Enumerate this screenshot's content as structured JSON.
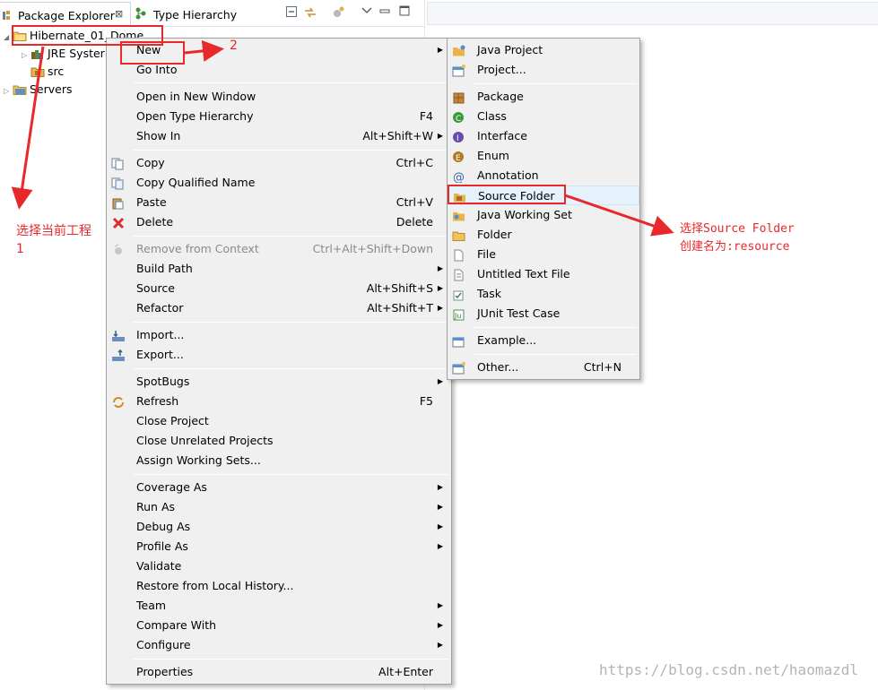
{
  "tabs": {
    "package_explorer": "Package Explorer",
    "close_glyph": "⊠",
    "type_hierarchy": "Type Hierarchy"
  },
  "tree": {
    "project": "Hibernate_01_Dome",
    "jre": "JRE Syster",
    "src": "src",
    "servers": "Servers"
  },
  "context_menu": {
    "new": "New",
    "go_into": "Go Into",
    "open_new_window": "Open in New Window",
    "open_type_hierarchy": "Open Type Hierarchy",
    "open_type_hierarchy_acc": "F4",
    "show_in": "Show In",
    "show_in_acc": "Alt+Shift+W",
    "copy": "Copy",
    "copy_acc": "Ctrl+C",
    "copy_qualified": "Copy Qualified Name",
    "paste": "Paste",
    "paste_acc": "Ctrl+V",
    "delete": "Delete",
    "delete_acc": "Delete",
    "remove_context": "Remove from Context",
    "remove_context_acc": "Ctrl+Alt+Shift+Down",
    "build_path": "Build Path",
    "source": "Source",
    "source_acc": "Alt+Shift+S",
    "refactor": "Refactor",
    "refactor_acc": "Alt+Shift+T",
    "import": "Import...",
    "export": "Export...",
    "spotbugs": "SpotBugs",
    "refresh": "Refresh",
    "refresh_acc": "F5",
    "close_project": "Close Project",
    "close_unrelated": "Close Unrelated Projects",
    "assign_working_sets": "Assign Working Sets...",
    "coverage_as": "Coverage As",
    "run_as": "Run As",
    "debug_as": "Debug As",
    "profile_as": "Profile As",
    "validate": "Validate",
    "restore_history": "Restore from Local History...",
    "team": "Team",
    "compare_with": "Compare With",
    "configure": "Configure",
    "properties": "Properties",
    "properties_acc": "Alt+Enter"
  },
  "submenu": {
    "java_project": "Java Project",
    "project": "Project...",
    "package": "Package",
    "class": "Class",
    "interface": "Interface",
    "enum": "Enum",
    "annotation": "Annotation",
    "source_folder": "Source Folder",
    "java_working_set": "Java Working Set",
    "folder": "Folder",
    "file": "File",
    "untitled_text_file": "Untitled Text File",
    "task": "Task",
    "junit_test_case": "JUnit Test Case",
    "example": "Example...",
    "other": "Other...",
    "other_acc": "Ctrl+N"
  },
  "annotations": {
    "step1_line1": "选择当前工程",
    "step1_line2": "1",
    "step2": "2",
    "step3_line1": "选择Source Folder",
    "step3_line2": "创建名为:resource"
  },
  "watermark": "https://blog.csdn.net/haomazdl",
  "colors": {
    "annotation_red": "#e8282a",
    "menu_bg": "#f0f0f0",
    "highlight": "#e5f1fb"
  }
}
